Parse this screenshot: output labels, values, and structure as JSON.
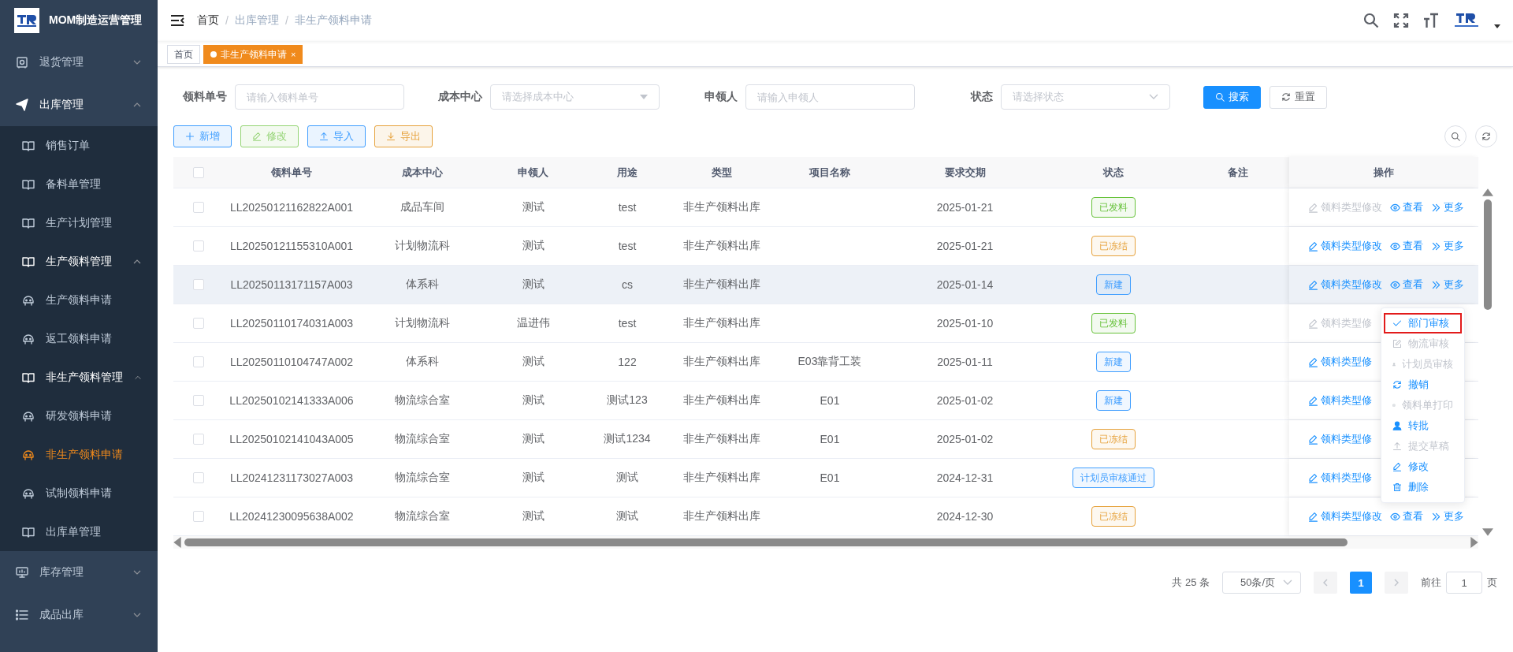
{
  "app": {
    "title": "MOM制造运营管理"
  },
  "sidebar": {
    "items": [
      {
        "label": "退货管理",
        "kind": "safe",
        "expanded": false,
        "selected": false
      },
      {
        "label": "出库管理",
        "kind": "plane",
        "expanded": true,
        "selected": false,
        "children": [
          {
            "label": "销售订单",
            "kind": "book",
            "selected": false
          },
          {
            "label": "备料单管理",
            "kind": "book",
            "selected": false
          },
          {
            "label": "生产计划管理",
            "kind": "book",
            "selected": false
          },
          {
            "label": "生产领料管理",
            "kind": "book",
            "expanded": true,
            "selected": false,
            "children": [
              {
                "label": "生产领料申请",
                "kind": "robot",
                "selected": false
              },
              {
                "label": "返工领料申请",
                "kind": "robot",
                "selected": false
              }
            ]
          },
          {
            "label": "非生产领料管理",
            "kind": "book",
            "expanded": true,
            "selected": false,
            "children": [
              {
                "label": "研发领料申请",
                "kind": "robot",
                "selected": false
              },
              {
                "label": "非生产领料申请",
                "kind": "robot",
                "selected": true
              },
              {
                "label": "试制领料申请",
                "kind": "robot",
                "selected": false
              }
            ]
          },
          {
            "label": "出库单管理",
            "kind": "book",
            "selected": false
          }
        ]
      },
      {
        "label": "库存管理",
        "kind": "monitor",
        "expanded": false,
        "selected": false
      },
      {
        "label": "成品出库",
        "kind": "list",
        "expanded": false,
        "selected": false
      }
    ]
  },
  "breadcrumb": [
    {
      "label": "首页"
    },
    {
      "separator": "/",
      "label": "出库管理"
    },
    {
      "separator": "/",
      "label": "非生产领料申请"
    }
  ],
  "tabs": [
    {
      "label": "首页",
      "selected": false
    },
    {
      "label": "非生产领料申请",
      "selected": true,
      "close": "×"
    }
  ],
  "filters": [
    {
      "kind": "input",
      "label": "领料单号",
      "placeholder": "请输入领料单号"
    },
    {
      "kind": "dropdown",
      "label": "成本中心",
      "placeholder": "请选择成本中心"
    },
    {
      "kind": "input",
      "label": "申领人",
      "placeholder": "请输入申领人"
    },
    {
      "kind": "select",
      "label": "状态",
      "placeholder": "请选择状态"
    }
  ],
  "search_buttons": [
    {
      "label": "搜索",
      "kind": "search"
    },
    {
      "label": "重置",
      "kind": "reset"
    }
  ],
  "toolbar": [
    {
      "label": "新增",
      "kind": "add",
      "color": "#409eff"
    },
    {
      "label": "修改",
      "kind": "edit",
      "color": "#95d475"
    },
    {
      "label": "导入",
      "kind": "import",
      "color": "#409eff"
    },
    {
      "label": "导出",
      "kind": "export",
      "color": "#e6a23c"
    }
  ],
  "table": {
    "all_checked": false,
    "columns": [
      "领料单号",
      "成本中心",
      "申领人",
      "用途",
      "类型",
      "项目名称",
      "要求交期",
      "状态",
      "备注",
      "操作"
    ],
    "rows": [
      {
        "checked": false,
        "highlighted": false,
        "cells": [
          "LL20250121162822A001",
          "成品车间",
          "测试",
          "test",
          "非生产领料出库"
        ],
        "due_date": "2025-01-21",
        "status": {
          "label": "已发料",
          "color": "#67c23a"
        },
        "actions": [
          {
            "kind": "edit",
            "label": "领料类型修改",
            "disabled": true
          },
          {
            "kind": "view",
            "label": "查看",
            "disabled": false
          },
          {
            "kind": "more",
            "label": "更多",
            "disabled": false
          }
        ]
      },
      {
        "checked": false,
        "highlighted": false,
        "cells": [
          "LL20250121155310A001",
          "计划物流科",
          "测试",
          "test",
          "非生产领料出库"
        ],
        "due_date": "2025-01-21",
        "status": {
          "label": "已冻结",
          "color": "#e6a23c"
        },
        "actions": [
          {
            "kind": "edit",
            "label": "领料类型修改",
            "disabled": false
          },
          {
            "kind": "view",
            "label": "查看",
            "disabled": false
          },
          {
            "kind": "more",
            "label": "更多",
            "disabled": false
          }
        ]
      },
      {
        "checked": false,
        "highlighted": true,
        "cells": [
          "LL20250113171157A003",
          "体系科",
          "测试",
          "cs",
          "非生产领料出库"
        ],
        "due_date": "2025-01-14",
        "status": {
          "label": "新建",
          "color": "#409eff"
        },
        "actions": [
          {
            "kind": "edit",
            "label": "领料类型修改",
            "disabled": false
          },
          {
            "kind": "view",
            "label": "查看",
            "disabled": false
          },
          {
            "kind": "more",
            "label": "更多",
            "disabled": false
          }
        ]
      },
      {
        "checked": false,
        "highlighted": false,
        "cells": [
          "LL20250110174031A003",
          "计划物流科",
          "温进伟",
          "test",
          "非生产领料出库"
        ],
        "due_date": "2025-01-10",
        "status": {
          "label": "已发料",
          "color": "#67c23a"
        },
        "actions": [
          {
            "kind": "edit",
            "label": "领料类型修",
            "disabled": true
          }
        ]
      },
      {
        "checked": false,
        "highlighted": false,
        "cells": [
          "LL20250110104747A002",
          "体系科",
          "测试",
          "122",
          "非生产领料出库"
        ],
        "project": "E03靠背工装",
        "due_date": "2025-01-11",
        "status": {
          "label": "新建",
          "color": "#409eff"
        },
        "actions": [
          {
            "kind": "edit",
            "label": "领料类型修",
            "disabled": false
          }
        ]
      },
      {
        "checked": false,
        "highlighted": false,
        "cells": [
          "LL20250102141333A006",
          "物流综合室",
          "测试",
          "测试123",
          "非生产领料出库"
        ],
        "project": "E01",
        "due_date": "2025-01-02",
        "status": {
          "label": "新建",
          "color": "#409eff"
        },
        "actions": [
          {
            "kind": "edit",
            "label": "领料类型修",
            "disabled": false
          }
        ]
      },
      {
        "checked": false,
        "highlighted": false,
        "cells": [
          "LL20250102141043A005",
          "物流综合室",
          "测试",
          "测试1234",
          "非生产领料出库"
        ],
        "project": "E01",
        "due_date": "2025-01-02",
        "status": {
          "label": "已冻结",
          "color": "#e6a23c"
        },
        "actions": [
          {
            "kind": "edit",
            "label": "领料类型修",
            "disabled": false
          }
        ]
      },
      {
        "checked": false,
        "highlighted": false,
        "cells": [
          "LL20241231173027A003",
          "物流综合室",
          "测试",
          "测试",
          "非生产领料出库"
        ],
        "project": "E01",
        "due_date": "2024-12-31",
        "status": {
          "label": "计划员审核通过",
          "color": "#409eff"
        },
        "actions": [
          {
            "kind": "edit",
            "label": "领料类型修",
            "disabled": false
          }
        ]
      },
      {
        "checked": false,
        "highlighted": false,
        "cells": [
          "LL20241230095638A002",
          "物流综合室",
          "测试",
          "测试",
          "非生产领料出库"
        ],
        "due_date": "2024-12-30",
        "status": {
          "label": "已冻结",
          "color": "#e6a23c"
        },
        "actions": [
          {
            "kind": "edit",
            "label": "领料类型修改",
            "disabled": false
          },
          {
            "kind": "view",
            "label": "查看",
            "disabled": false
          },
          {
            "kind": "more",
            "label": "更多",
            "disabled": false
          }
        ]
      }
    ]
  },
  "more_menu": {
    "items": [
      {
        "label": "部门审核",
        "kind": "check",
        "disabled": false,
        "outlined": true
      },
      {
        "label": "物流审核",
        "kind": "edit-box",
        "disabled": true,
        "outlined": false
      },
      {
        "label": "计划员审核",
        "kind": "user",
        "disabled": true,
        "outlined": false
      },
      {
        "label": "撤销",
        "kind": "refresh",
        "disabled": false,
        "outlined": false
      },
      {
        "label": "领料单打印",
        "kind": "print",
        "disabled": true,
        "outlined": false
      },
      {
        "label": "转批",
        "kind": "user",
        "disabled": false,
        "outlined": false
      },
      {
        "label": "提交草稿",
        "kind": "upload",
        "disabled": true,
        "outlined": false
      },
      {
        "label": "修改",
        "kind": "edit",
        "disabled": false,
        "outlined": false
      },
      {
        "label": "删除",
        "kind": "trash",
        "disabled": false,
        "outlined": false
      }
    ]
  },
  "pagination": {
    "total": "共 25 条",
    "page_size": "50条/页",
    "prev_disabled": true,
    "next_disabled": true,
    "pages": [
      {
        "label": "1",
        "selected": true
      }
    ],
    "goto_label": "前往",
    "goto_value": "1",
    "goto_suffix": "页"
  }
}
